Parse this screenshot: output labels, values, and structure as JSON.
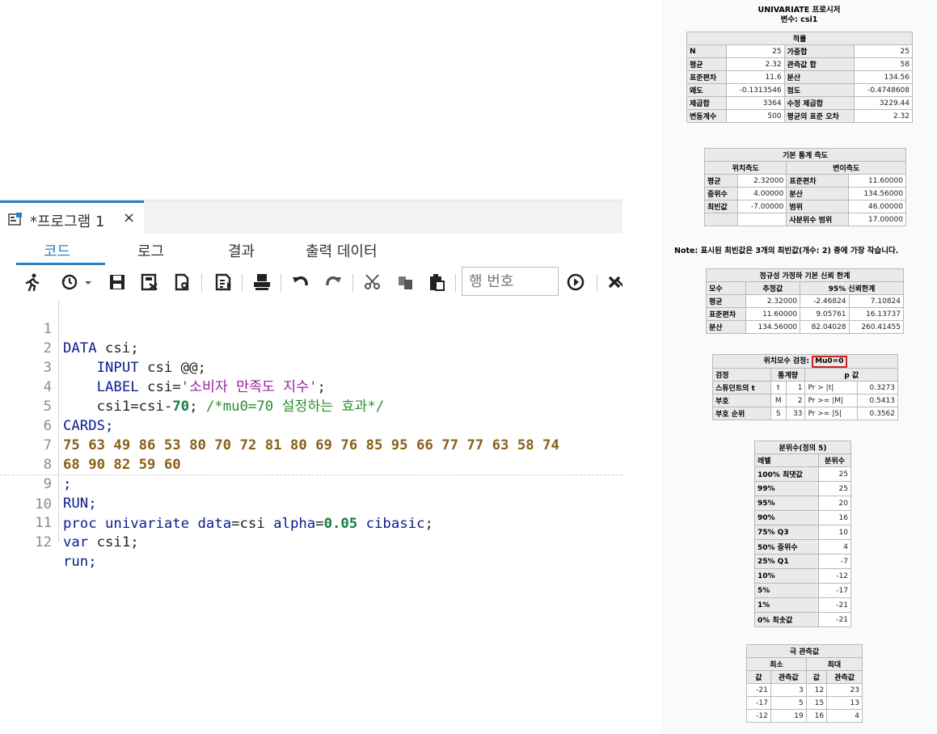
{
  "editor": {
    "tab_title": "*프로그램 1",
    "tab_close": "×",
    "subtabs": [
      "코드",
      "로그",
      "결과",
      "출력 데이터"
    ],
    "line_number_placeholder": "행 번호",
    "code_lines": [
      {
        "n": "1",
        "text": "DATA csi;"
      },
      {
        "n": "2",
        "text": "    INPUT csi @@;"
      },
      {
        "n": "3",
        "text": "    LABEL csi='소비자 만족도 지수';"
      },
      {
        "n": "4",
        "text": "    csi1=csi-70; /*mu0=70 설정하는 효과*/"
      },
      {
        "n": "5",
        "text": "CARDS;"
      },
      {
        "n": "6",
        "text": "75 63 49 86 53 80 70 72 81 80 69 76 85 95 66 77 77 63 58 74"
      },
      {
        "n": "7",
        "text": "68 90 82 59 60"
      },
      {
        "n": "8",
        "text": ";"
      },
      {
        "n": "9",
        "text": "RUN;"
      },
      {
        "n": "10",
        "text": "proc univariate data=csi alpha=0.05 cibasic;"
      },
      {
        "n": "11",
        "text": "var csi1;"
      },
      {
        "n": "12",
        "text": "run;"
      }
    ],
    "tokens": {
      "l1": [
        "DATA",
        " csi;"
      ],
      "l2": [
        "    INPUT",
        " csi @@;"
      ],
      "l3": [
        "    LABEL",
        " csi=",
        "'소비자 만족도 지수'",
        ";"
      ],
      "l4": [
        "    csi1=csi-",
        "70",
        "; ",
        "/*mu0=70 설정하는 효과*/"
      ],
      "l5": [
        "CARDS;"
      ],
      "l6": [
        "75 63 49 86 53 80 70 72 81 80 69 76 85 95 66 77 77 63 58 74"
      ],
      "l7": [
        "68 90 82 59 60"
      ],
      "l8": [
        ";"
      ],
      "l9": [
        "RUN;"
      ],
      "l10": [
        "proc univariate",
        " data",
        "=csi ",
        "alpha",
        "=",
        "0.05",
        " cibasic",
        ";"
      ],
      "l11": [
        "var",
        " csi1;"
      ],
      "l12": [
        "run;"
      ]
    }
  },
  "output": {
    "title1": "UNIVARIATE 프로시저",
    "title2": "변수: csi1",
    "moments": {
      "header": "적률",
      "rows": [
        [
          "N",
          "25",
          "가중합",
          "25"
        ],
        [
          "평균",
          "2.32",
          "관측값 합",
          "58"
        ],
        [
          "표준편차",
          "11.6",
          "분산",
          "134.56"
        ],
        [
          "왜도",
          "-0.1313546",
          "첨도",
          "-0.4748608"
        ],
        [
          "제곱합",
          "3364",
          "수정 제곱합",
          "3229.44"
        ],
        [
          "변동계수",
          "500",
          "평균의 표준 오차",
          "2.32"
        ]
      ]
    },
    "basic": {
      "header": "기본 통계 측도",
      "col1": "위치측도",
      "col2": "변이측도",
      "rows": [
        [
          "평균",
          "2.32000",
          "표준편차",
          "11.60000"
        ],
        [
          "중위수",
          "4.00000",
          "분산",
          "134.56000"
        ],
        [
          "최빈값",
          "-7.00000",
          "범위",
          "46.00000"
        ],
        [
          "",
          "",
          "사분위수 범위",
          "17.00000"
        ]
      ]
    },
    "note": "Note: 표시된 최빈값은 3개의 최빈값(개수: 2) 중에 가장 작습니다.",
    "ci": {
      "header": "정규성 가정하 기본 신뢰 한계",
      "cols": [
        "모수",
        "추정값",
        "95% 신뢰한계"
      ],
      "rows": [
        [
          "평균",
          "2.32000",
          "-2.46824",
          "7.10824"
        ],
        [
          "표준편차",
          "11.60000",
          "9.05761",
          "16.13737"
        ],
        [
          "분산",
          "134.56000",
          "82.04028",
          "260.41455"
        ]
      ]
    },
    "tests": {
      "header_prefix": "위치모수 검정:",
      "header_mu": "Mu0=0",
      "cols": [
        "검정",
        "통계량",
        "p 값"
      ],
      "rows": [
        [
          "스튜던트의 t",
          "t",
          "1",
          "Pr > |t|",
          "0.3273"
        ],
        [
          "부호",
          "M",
          "2",
          "Pr >= |M|",
          "0.5413"
        ],
        [
          "부호 순위",
          "S",
          "33",
          "Pr >= |S|",
          "0.3562"
        ]
      ]
    },
    "quantiles": {
      "header": "분위수(정의 5)",
      "cols": [
        "레벨",
        "분위수"
      ],
      "rows": [
        [
          "100% 최댓값",
          "25"
        ],
        [
          "99%",
          "25"
        ],
        [
          "95%",
          "20"
        ],
        [
          "90%",
          "16"
        ],
        [
          "75% Q3",
          "10"
        ],
        [
          "50% 중위수",
          "4"
        ],
        [
          "25% Q1",
          "-7"
        ],
        [
          "10%",
          "-12"
        ],
        [
          "5%",
          "-17"
        ],
        [
          "1%",
          "-21"
        ],
        [
          "0% 최솟값",
          "-21"
        ]
      ]
    },
    "extremes": {
      "header": "극 관측값",
      "col_min": "최소",
      "col_max": "최대",
      "sub": [
        "값",
        "관측값",
        "값",
        "관측값"
      ],
      "rows": [
        [
          "-21",
          "3",
          "12",
          "23"
        ],
        [
          "-17",
          "5",
          "15",
          "13"
        ],
        [
          "-12",
          "19",
          "16",
          "4"
        ]
      ]
    }
  }
}
